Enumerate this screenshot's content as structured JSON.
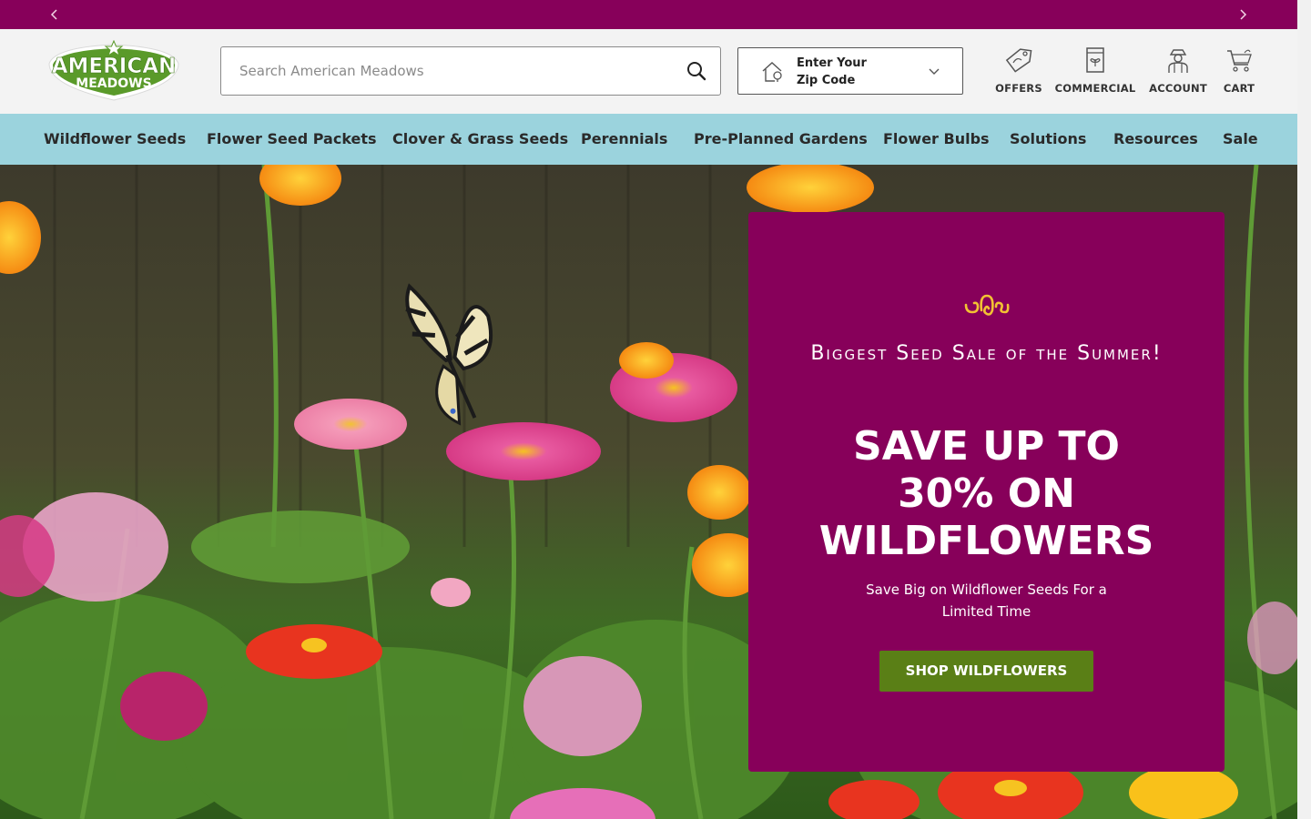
{
  "promo_bar": {
    "prev_icon": "chevron-left-icon",
    "next_icon": "chevron-right-icon",
    "color": "#87005a"
  },
  "brand": {
    "logo_line1": "AMERICAN",
    "logo_line2": "MEADOWS",
    "logo_color": "#5a9a2a"
  },
  "search": {
    "placeholder": "Search American Meadows",
    "value": "",
    "icon": "search-icon"
  },
  "zip": {
    "line1": "Enter Your",
    "line2": "Zip Code",
    "icon": "home-location-icon"
  },
  "utility": [
    {
      "label": "OFFERS",
      "icon": "tag-icon"
    },
    {
      "label": "COMMERCIAL",
      "icon": "seed-packet-icon"
    },
    {
      "label": "ACCOUNT",
      "icon": "gardener-icon"
    },
    {
      "label": "CART",
      "icon": "cart-icon"
    }
  ],
  "nav": {
    "color": "#9bd3dd",
    "items": [
      "Wildflower Seeds",
      "Flower Seed Packets",
      "Clover & Grass Seeds",
      "Perennials",
      "Pre-Planned Gardens",
      "Flower Bulbs",
      "Solutions",
      "Resources",
      "Sale"
    ]
  },
  "hero": {
    "image": "butterfly-on-zinnias-photo",
    "card": {
      "color": "#87005a",
      "flourish_icon": "flourish-icon",
      "eyebrow": "Biggest Seed Sale of the Summer!",
      "headline_line1": "SAVE UP TO",
      "headline_line2": "30% ON",
      "headline_line3": "WILDFLOWERS",
      "subtext": "Save Big on Wildflower Seeds For a Limited Time",
      "cta": "SHOP WILDFLOWERS",
      "cta_color": "#5a7f16"
    }
  }
}
